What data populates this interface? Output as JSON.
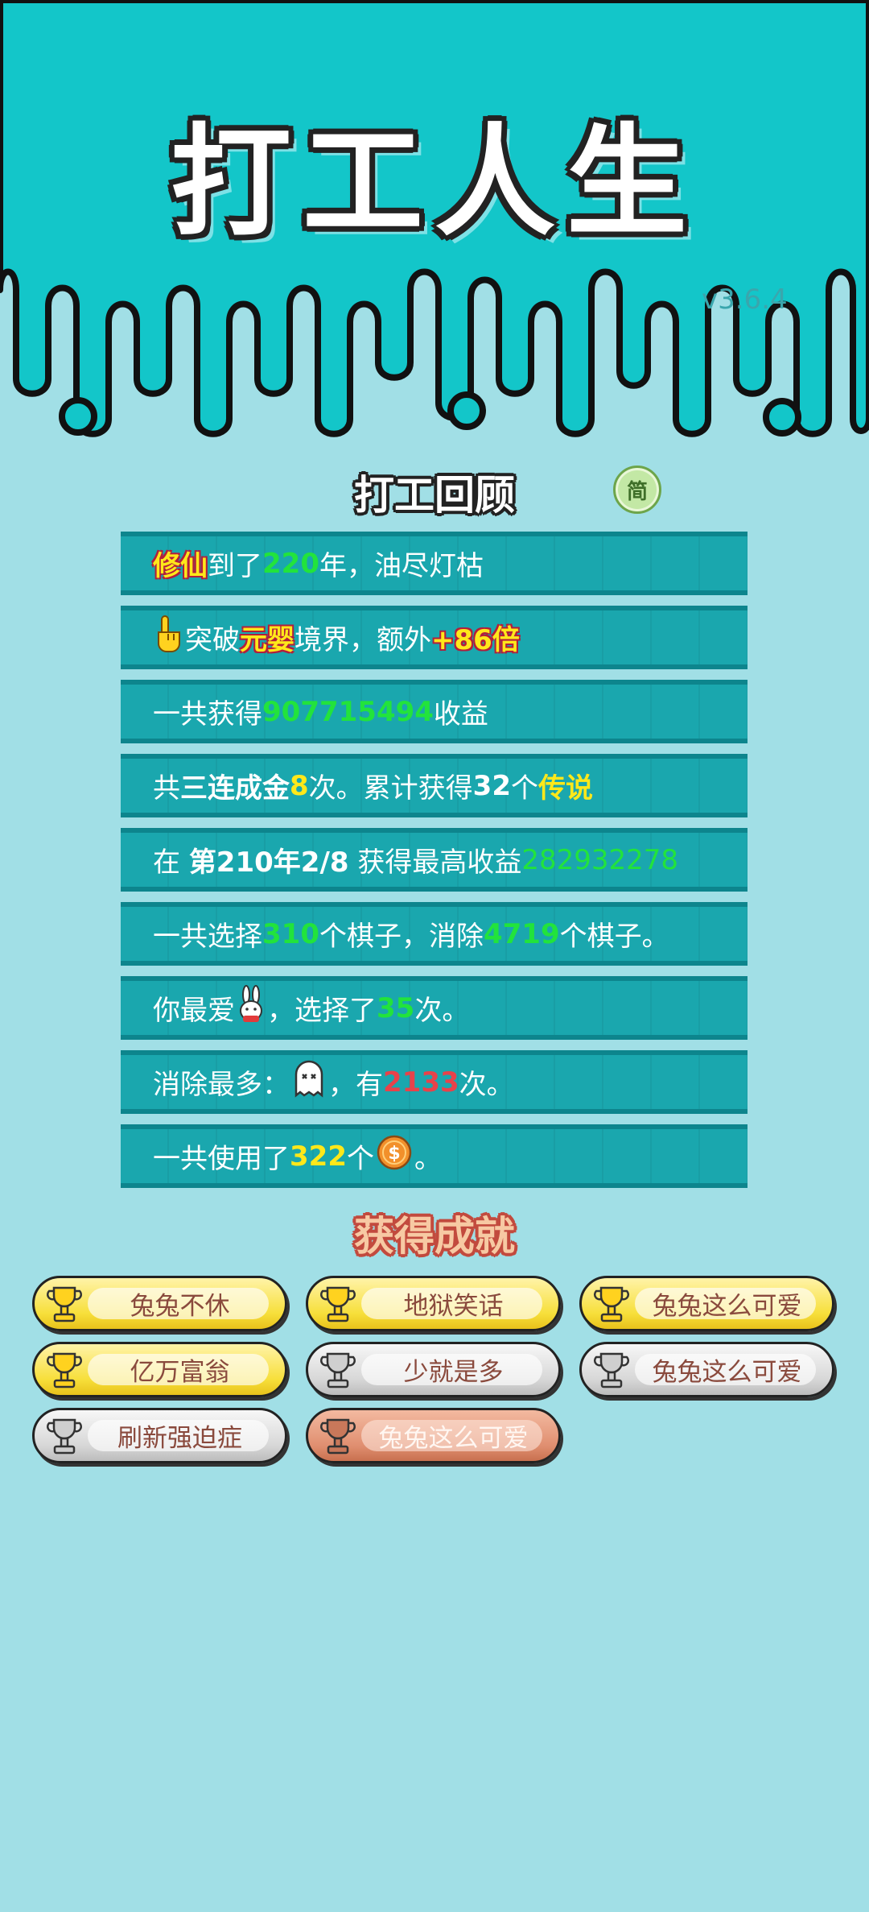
{
  "app": {
    "title": "打工人生",
    "version": "v3.6.4"
  },
  "review": {
    "title": "打工回顾",
    "mode_button": "简",
    "rows": [
      {
        "parts": [
          "修仙",
          "到了",
          "220",
          "年，油尽灯枯"
        ]
      },
      {
        "parts": [
          "突破",
          "元婴",
          "境界，额外",
          "+86倍"
        ],
        "icon": "hand-pointer-icon"
      },
      {
        "parts": [
          "一共获得",
          "907715494",
          "收益"
        ]
      },
      {
        "parts": [
          "共",
          "三连成金",
          "8",
          "次。累计获得",
          "32",
          "个",
          "传说"
        ]
      },
      {
        "parts": [
          "在 ",
          "第210年2/8",
          " 获得最高收益",
          "282932278"
        ]
      },
      {
        "parts": [
          "一共选择",
          "310",
          "个棋子，消除",
          "4719",
          "个棋子。"
        ]
      },
      {
        "parts": [
          "你最爱",
          "，选择了",
          "35",
          "次。"
        ],
        "icon": "rabbit-icon"
      },
      {
        "parts": [
          "消除最多：",
          "，有",
          "2133",
          "次。"
        ],
        "icon": "ghost-icon"
      },
      {
        "parts": [
          "一共使用了",
          "322",
          "个",
          "。"
        ],
        "icon": "coin-icon"
      }
    ]
  },
  "achievements": {
    "title": "获得成就",
    "items": [
      {
        "label": "兔兔不休",
        "tier": "gold"
      },
      {
        "label": "地狱笑话",
        "tier": "gold"
      },
      {
        "label": "兔兔这么可爱",
        "tier": "gold"
      },
      {
        "label": "亿万富翁",
        "tier": "gold"
      },
      {
        "label": "少就是多",
        "tier": "silver"
      },
      {
        "label": "兔兔这么可爱",
        "tier": "silver"
      },
      {
        "label": "刷新强迫症",
        "tier": "silver"
      },
      {
        "label": "兔兔这么可爱",
        "tier": "bronze"
      }
    ]
  },
  "colors": {
    "header_bg": "#13c6c9",
    "page_bg": "#a1dfe6",
    "row_bg": "#1aa7ae",
    "highlight_green": "#22e33c",
    "highlight_yellow": "#ffe81a",
    "highlight_red": "#e8424a"
  }
}
